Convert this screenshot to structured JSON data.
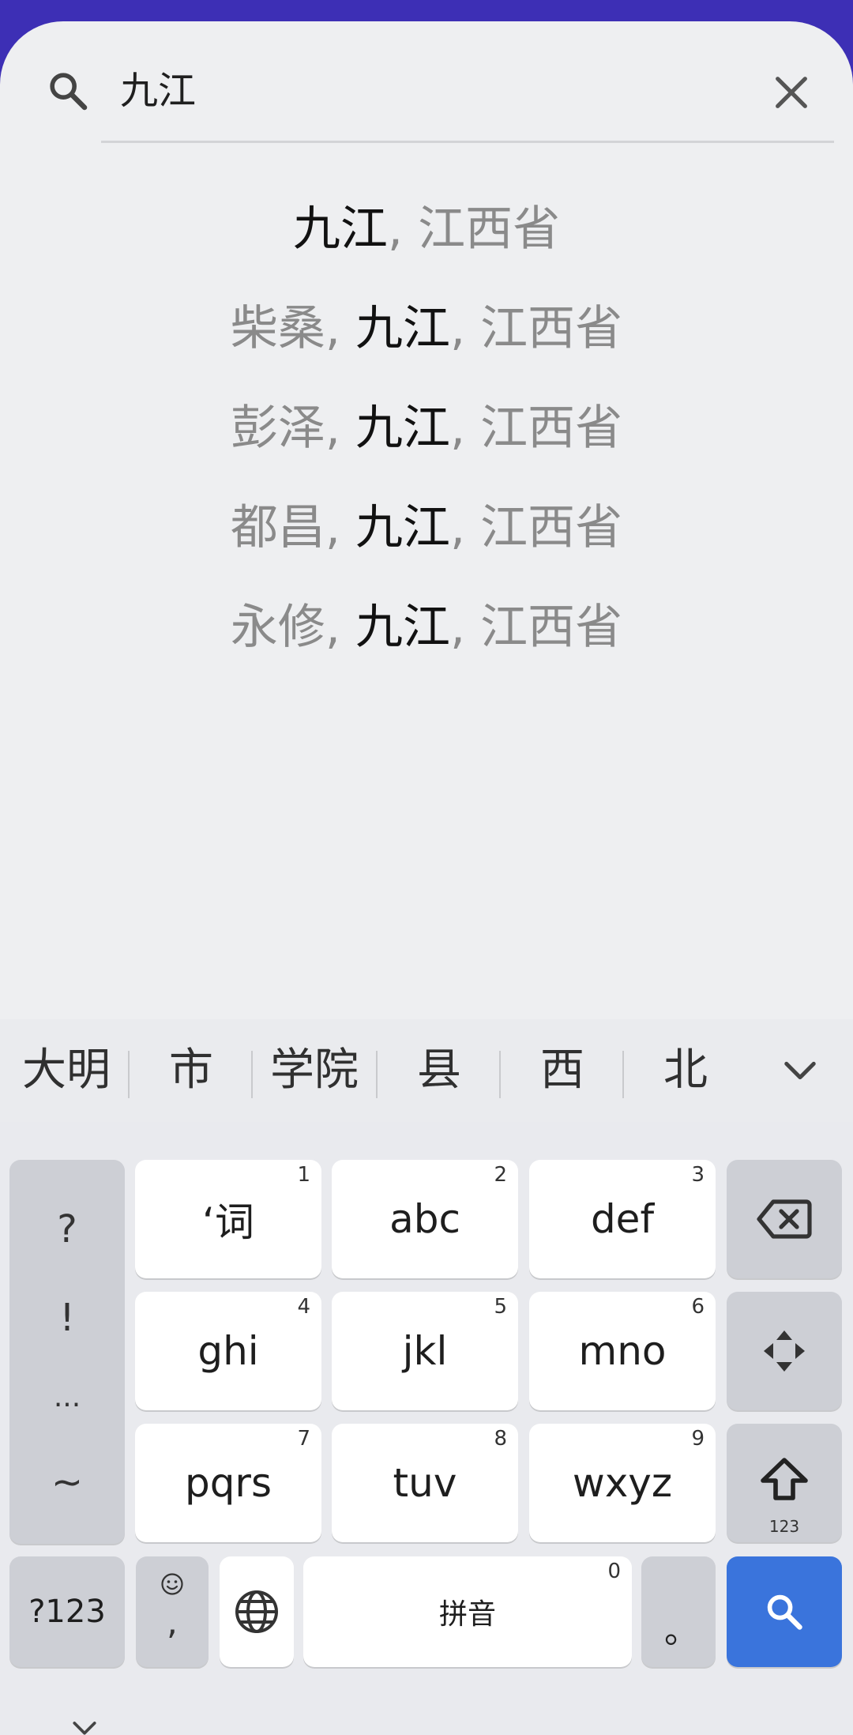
{
  "search": {
    "query": "九江"
  },
  "results": [
    {
      "pre": "",
      "match": "九江",
      "post": ", 江西省"
    },
    {
      "pre": "柴桑, ",
      "match": "九江",
      "post": ", 江西省"
    },
    {
      "pre": "彭泽, ",
      "match": "九江",
      "post": ", 江西省"
    },
    {
      "pre": "都昌, ",
      "match": "九江",
      "post": ", 江西省"
    },
    {
      "pre": "永修, ",
      "match": "九江",
      "post": ", 江西省"
    }
  ],
  "suggestions": [
    "大明",
    "市",
    "学院",
    "县",
    "西",
    "北"
  ],
  "keyboard": {
    "left_symbols": [
      "?",
      "!",
      "...",
      "~"
    ],
    "keys": [
      {
        "label": "‘词",
        "num": "1"
      },
      {
        "label": "abc",
        "num": "2"
      },
      {
        "label": "def",
        "num": "3"
      },
      {
        "label": "ghi",
        "num": "4"
      },
      {
        "label": "jkl",
        "num": "5"
      },
      {
        "label": "mno",
        "num": "6"
      },
      {
        "label": "pqrs",
        "num": "7"
      },
      {
        "label": "tuv",
        "num": "8"
      },
      {
        "label": "wxyz",
        "num": "9"
      }
    ],
    "shift_sub": "123",
    "symbols_key": "?123",
    "emoji_comma": ",",
    "space_label": "拼音",
    "space_num": "0",
    "period": "。"
  },
  "colors": {
    "status_bar": "#3d2fb5",
    "search_key": "#3a74dc",
    "match_text": "#111111",
    "context_text": "#8a8a8a"
  }
}
